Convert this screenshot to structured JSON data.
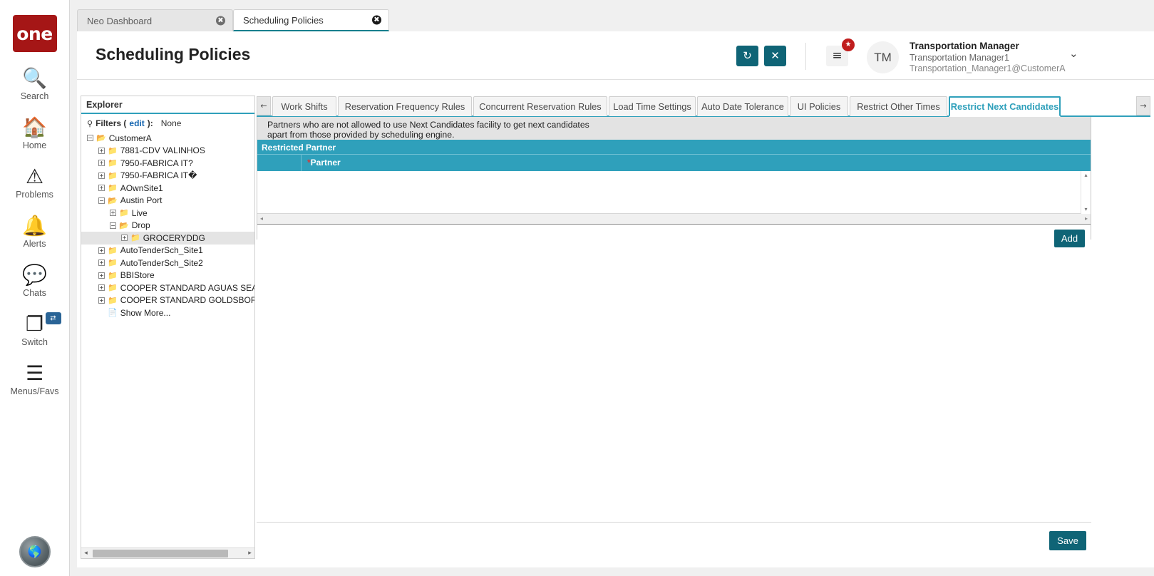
{
  "rail": {
    "logo_text": "one",
    "items": [
      {
        "label": "Search",
        "icon": "search-icon"
      },
      {
        "label": "Home",
        "icon": "home-icon"
      },
      {
        "label": "Problems",
        "icon": "warning-triangle-icon"
      },
      {
        "label": "Alerts",
        "icon": "bell-icon"
      },
      {
        "label": "Chats",
        "icon": "chat-bubble-icon"
      },
      {
        "label": "Switch",
        "icon": "windows-stack-icon"
      },
      {
        "label": "Menus/Favs",
        "icon": "hamburger-icon"
      }
    ],
    "switch_badge": "⇄",
    "bottom_avatar": "globe-avatar-icon"
  },
  "browser_tabs": [
    {
      "label": "Neo Dashboard",
      "active": false,
      "close": "✖"
    },
    {
      "label": "Scheduling Policies",
      "active": true,
      "close": "✖"
    }
  ],
  "header": {
    "title": "Scheduling Policies",
    "refresh_icon": "↻",
    "close_icon": "✕",
    "menu_icon": "≡",
    "menu_badge": "★",
    "avatar_initials": "TM",
    "user_name": "Transportation Manager",
    "user_role": "Transportation Manager1",
    "user_email": "Transportation_Manager1@CustomerA",
    "caret_icon": "⌄"
  },
  "explorer": {
    "title": "Explorer",
    "filters_icon": "⚲",
    "filters_label": "Filters (",
    "filters_edit": "edit",
    "filters_label_end": "):",
    "filters_value": "None",
    "scroll_left": "◂",
    "scroll_right": "▸",
    "tree": [
      {
        "label": "CustomerA",
        "depth": 0,
        "toggle": "−",
        "icon": "folder-open-icon",
        "selected": false
      },
      {
        "label": "7881-CDV VALINHOS",
        "depth": 1,
        "toggle": "+",
        "icon": "folder-closed-icon",
        "selected": false
      },
      {
        "label": "7950-FABRICA IT?",
        "depth": 1,
        "toggle": "+",
        "icon": "folder-closed-icon",
        "selected": false
      },
      {
        "label": "7950-FABRICA IT�",
        "depth": 1,
        "toggle": "+",
        "icon": "folder-closed-icon",
        "selected": false
      },
      {
        "label": "AOwnSite1",
        "depth": 1,
        "toggle": "+",
        "icon": "folder-closed-icon",
        "selected": false
      },
      {
        "label": "Austin Port",
        "depth": 1,
        "toggle": "−",
        "icon": "folder-open-icon",
        "selected": false
      },
      {
        "label": "Live",
        "depth": 2,
        "toggle": "+",
        "icon": "folder-closed-icon",
        "selected": false
      },
      {
        "label": "Drop",
        "depth": 2,
        "toggle": "−",
        "icon": "folder-open-icon",
        "selected": false
      },
      {
        "label": "GROCERYDDG",
        "depth": 3,
        "toggle": "+",
        "icon": "folder-closed-icon",
        "selected": true
      },
      {
        "label": "AutoTenderSch_Site1",
        "depth": 1,
        "toggle": "+",
        "icon": "folder-closed-icon",
        "selected": false
      },
      {
        "label": "AutoTenderSch_Site2",
        "depth": 1,
        "toggle": "+",
        "icon": "folder-closed-icon",
        "selected": false
      },
      {
        "label": "BBIStore",
        "depth": 1,
        "toggle": "+",
        "icon": "folder-closed-icon",
        "selected": false
      },
      {
        "label": "COOPER STANDARD AGUAS SEALING (",
        "depth": 1,
        "toggle": "+",
        "icon": "folder-closed-icon",
        "selected": false
      },
      {
        "label": "COOPER STANDARD GOLDSBORO",
        "depth": 1,
        "toggle": "+",
        "icon": "folder-closed-icon",
        "selected": false
      },
      {
        "label": "Show More...",
        "depth": 1,
        "toggle": "",
        "icon": "document-icon",
        "selected": false
      }
    ]
  },
  "tabs": {
    "scroll_left_icon": "←",
    "scroll_right_icon": "→",
    "items": [
      {
        "label": "Work Shifts",
        "active": false
      },
      {
        "label": "Reservation Frequency Rules",
        "active": false
      },
      {
        "label": "Concurrent Reservation Rules",
        "active": false
      },
      {
        "label": "Load Time Settings",
        "active": false
      },
      {
        "label": "Auto Date Tolerance",
        "active": false
      },
      {
        "label": "UI Policies",
        "active": false
      },
      {
        "label": "Restrict Other Times",
        "active": false
      },
      {
        "label": "Restrict Next Candidates",
        "active": true
      }
    ]
  },
  "panel": {
    "note_line1": "Partners who are not allowed to use Next Candidates facility to get next candidates",
    "note_line2": "apart from those provided by scheduling engine.",
    "grid_title": "Restricted Partner",
    "column_required_marker": "*",
    "column_partner": "Partner",
    "rows": [],
    "add_label": "Add",
    "vscroll_up": "▴",
    "vscroll_down": "▾",
    "hscroll_left": "◂",
    "hscroll_right": "▸"
  },
  "footer": {
    "save_label": "Save"
  },
  "colors": {
    "brand_red": "#a51616",
    "teal_dark": "#0f6476",
    "teal_accent": "#2fa0bb",
    "badge_red": "#c01d1d",
    "required_red": "#d43b3b"
  }
}
